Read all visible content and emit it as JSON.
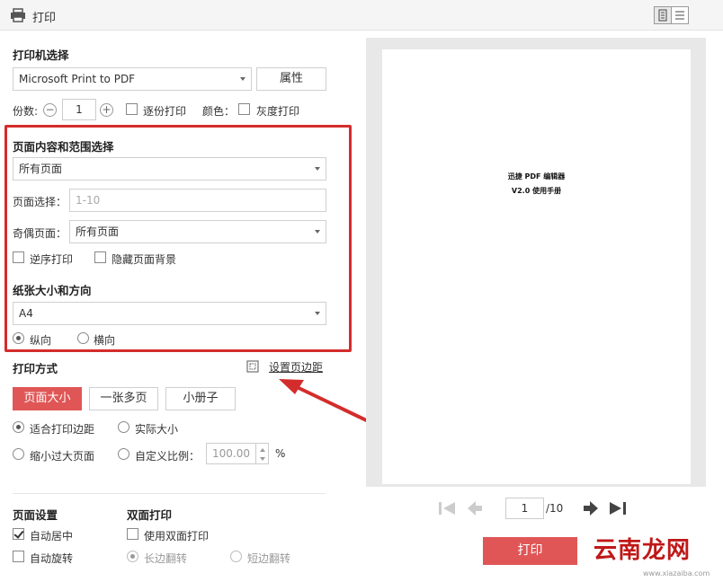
{
  "window": {
    "title": "打印"
  },
  "printer": {
    "section_title": "打印机选择",
    "selected": "Microsoft Print to PDF",
    "properties_label": "属性",
    "copies_label": "份数:",
    "copies_value": "1",
    "collate_label": "逐份打印",
    "color_label": "颜色：",
    "grayscale_label": "灰度打印"
  },
  "page_range": {
    "section_title": "页面内容和范围选择",
    "selected": "所有页面",
    "page_select_label": "页面选择：",
    "page_select_placeholder": "1-10",
    "odd_even_label": "奇偶页面：",
    "odd_even_selected": "所有页面",
    "reverse_label": "逆序打印",
    "hide_bg_label": "隐藏页面背景"
  },
  "paper": {
    "section_title": "纸张大小和方向",
    "size_selected": "A4",
    "portrait_label": "纵向",
    "landscape_label": "横向"
  },
  "print_mode": {
    "section_title": "打印方式",
    "margin_link": "设置页边距",
    "tabs": [
      "页面大小",
      "一张多页",
      "小册子"
    ],
    "fit_margin_label": "适合打印边距",
    "actual_size_label": "实际大小",
    "shrink_label": "缩小过大页面",
    "custom_scale_label": "自定义比例：",
    "scale_value": "100.00",
    "percent": "%"
  },
  "page_settings": {
    "section_title": "页面设置",
    "auto_center_label": "自动居中",
    "auto_rotate_label": "自动旋转"
  },
  "duplex": {
    "section_title": "双面打印",
    "use_duplex_label": "使用双面打印",
    "long_edge_label": "长边翻转",
    "short_edge_label": "短边翻转"
  },
  "preview": {
    "line1": "迅捷 PDF 编辑器",
    "line2": "V2.0 使用手册",
    "page_value": "1",
    "total_pages": "/10"
  },
  "actions": {
    "print_label": "打印"
  },
  "watermark": {
    "text": "云南龙网",
    "sub": "www.xiazaiba.com"
  },
  "colors": {
    "accent": "#e05656",
    "highlight_box": "#d42c2c"
  }
}
